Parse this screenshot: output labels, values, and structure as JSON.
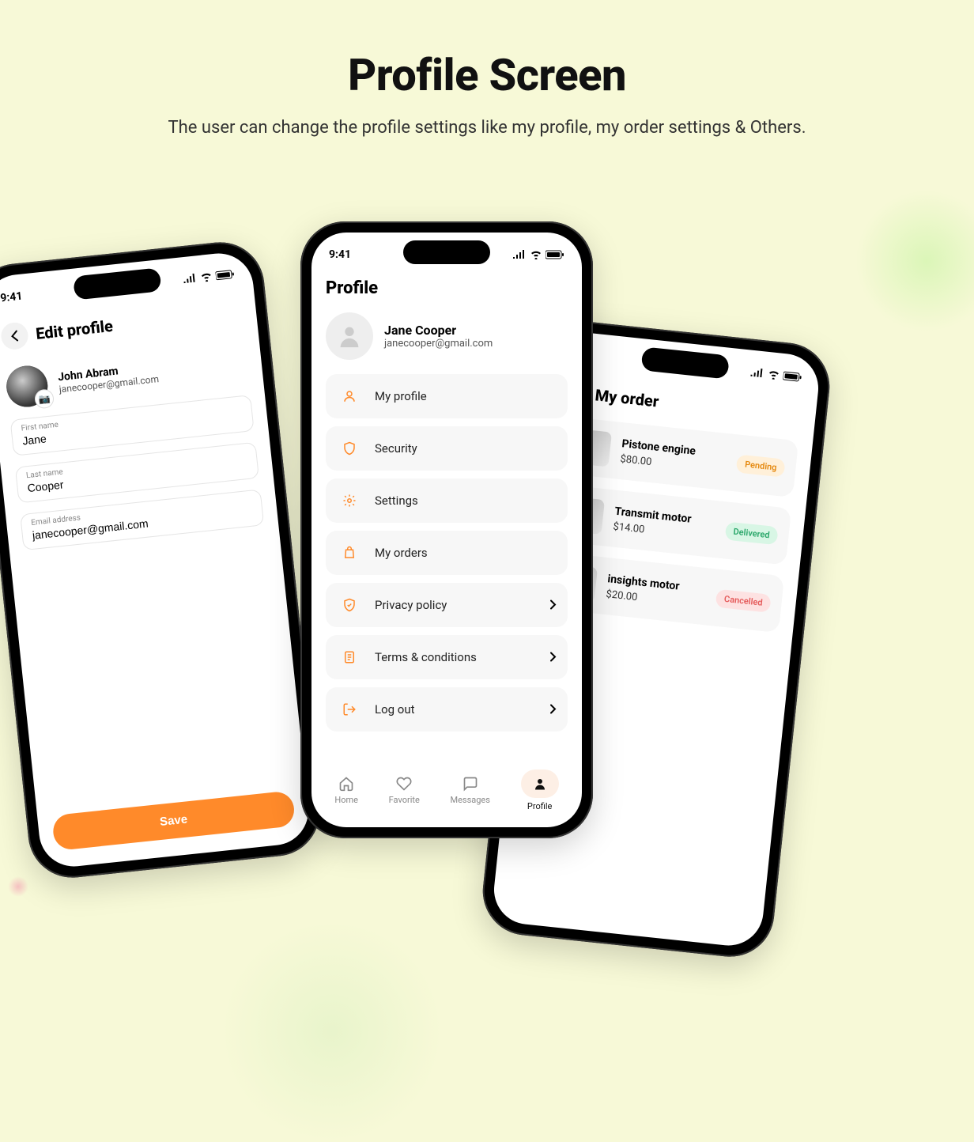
{
  "hero": {
    "title": "Profile Screen",
    "subtitle": "The user can change the profile settings like my profile, my order settings & Others."
  },
  "status": {
    "time": "9:41"
  },
  "editProfile": {
    "title": "Edit profile",
    "user": {
      "name": "John Abram",
      "email": "janecooper@gmail.com"
    },
    "fields": {
      "firstNameLabel": "First name",
      "firstName": "Jane",
      "lastNameLabel": "Last name",
      "lastName": "Cooper",
      "emailLabel": "Email address",
      "email": "janecooper@gmail.com"
    },
    "saveLabel": "Save"
  },
  "profile": {
    "title": "Profile",
    "user": {
      "name": "Jane Cooper",
      "email": "janecooper@gmail.com"
    },
    "menu": [
      {
        "key": "my-profile",
        "label": "My profile",
        "icon": "user-icon"
      },
      {
        "key": "security",
        "label": "Security",
        "icon": "shield-icon"
      },
      {
        "key": "settings",
        "label": "Settings",
        "icon": "gear-icon"
      },
      {
        "key": "my-orders",
        "label": "My orders",
        "icon": "bag-icon"
      },
      {
        "key": "privacy",
        "label": "Privacy policy",
        "icon": "shield-check-icon"
      },
      {
        "key": "terms",
        "label": "Terms & conditions",
        "icon": "doc-icon"
      },
      {
        "key": "logout",
        "label": "Log out",
        "icon": "logout-icon"
      }
    ],
    "nav": {
      "home": "Home",
      "favorite": "Favorite",
      "messages": "Messages",
      "profile": "Profile"
    }
  },
  "orders": {
    "title": "My order",
    "items": [
      {
        "name": "Pistone engine",
        "price": "$80.00",
        "status": "Pending",
        "statusClass": "b-pend"
      },
      {
        "name": "Transmit motor",
        "price": "$14.00",
        "status": "Delivered",
        "statusClass": "b-deliv"
      },
      {
        "name": "insights motor",
        "price": "$20.00",
        "status": "Cancelled",
        "statusClass": "b-cancel"
      }
    ]
  },
  "colors": {
    "accent": "#ff8a2a"
  }
}
